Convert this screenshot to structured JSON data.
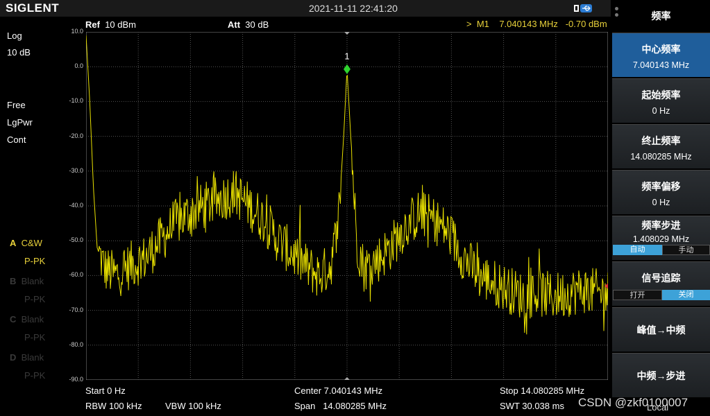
{
  "header": {
    "brand": "SIGLENT",
    "datetime": "2021-11-11 22:41:20"
  },
  "info_bar": {
    "ref_label": "Ref",
    "ref_value": "10 dBm",
    "att_label": "Att",
    "att_value": "30 dB",
    "marker_readout": ">  M1    7.040143 MHz   -0.70 dBm"
  },
  "left_panel": {
    "scale_type": "Log",
    "scale_div": "10 dB",
    "trigger": "Free",
    "detector": "LgPwr",
    "sweep_mode": "Cont",
    "traces": [
      {
        "letter": "A",
        "mode": "C&W",
        "detect": "P-PK",
        "active": true
      },
      {
        "letter": "B",
        "mode": "Blank",
        "detect": "P-PK",
        "active": false
      },
      {
        "letter": "C",
        "mode": "Blank",
        "detect": "P-PK",
        "active": false
      },
      {
        "letter": "D",
        "mode": "Blank",
        "detect": "P-PK",
        "active": false
      }
    ]
  },
  "y_axis": {
    "labels": [
      "10.0",
      "0.0",
      "-10.0",
      "-20.0",
      "-30.0",
      "-40.0",
      "-50.0",
      "-60.0",
      "-70.0",
      "-80.0",
      "-90.0"
    ]
  },
  "marker": {
    "label": "1",
    "freq_mhz": 7.040143,
    "level_dbm": -0.7
  },
  "bottom": {
    "start": "Start  0 Hz",
    "center": "Center  7.040143 MHz",
    "stop": "Stop  14.080285 MHz",
    "rbw": "RBW  100 kHz",
    "vbw": "VBW  100 kHz",
    "span": "Span   14.080285 MHz",
    "swt": "SWT  30.038 ms"
  },
  "menu": {
    "title": "频率",
    "center_freq_label": "中心频率",
    "center_freq_value": "7.040143 MHz",
    "start_freq_label": "起始频率",
    "start_freq_value": "0 Hz",
    "stop_freq_label": "终止频率",
    "stop_freq_value": "14.080285 MHz",
    "freq_offset_label": "频率偏移",
    "freq_offset_value": "0 Hz",
    "freq_step_label": "频率步进",
    "freq_step_value": "1.408029 MHz",
    "auto_label": "自动",
    "manual_label": "手动",
    "signal_track_label": "信号追踪",
    "on_label": "打开",
    "off_label": "关闭",
    "peak_to_center_label": "峰值→中频",
    "center_to_step_label": "中频→步进",
    "local_label": "Local"
  },
  "watermark": "CSDN @zkf0100007",
  "chart_data": {
    "type": "line",
    "title": "",
    "xlabel": "",
    "ylabel": "",
    "xlim": [
      0,
      14.080285
    ],
    "ylim": [
      -90,
      10
    ],
    "grid": true,
    "series": [
      {
        "x": [
          0.0,
          0.1,
          0.2,
          0.3,
          0.5,
          0.8,
          1.2,
          1.6,
          2.0,
          2.4,
          2.8,
          3.2,
          3.6,
          4.0,
          4.4,
          4.8,
          5.2,
          5.6,
          6.0,
          6.3,
          6.6,
          6.8,
          6.95,
          7.04,
          7.13,
          7.3,
          7.5,
          7.8,
          8.2,
          8.6,
          9.0,
          9.4,
          9.8,
          10.2,
          10.6,
          11.0,
          11.4,
          11.8,
          12.2,
          12.6,
          13.0,
          13.4,
          13.8,
          14.08
        ],
        "y": [
          9,
          -10,
          -35,
          -52,
          -58,
          -60,
          -57,
          -55,
          -50,
          -45,
          -42,
          -40,
          -38,
          -36,
          -40,
          -44,
          -50,
          -54,
          -58,
          -60,
          -57,
          -45,
          -20,
          -0.7,
          -18,
          -50,
          -58,
          -56,
          -52,
          -46,
          -42,
          -44,
          -48,
          -55,
          -60,
          -62,
          -64,
          -66,
          -65,
          -66,
          -65,
          -64,
          -65,
          -65
        ]
      }
    ]
  }
}
